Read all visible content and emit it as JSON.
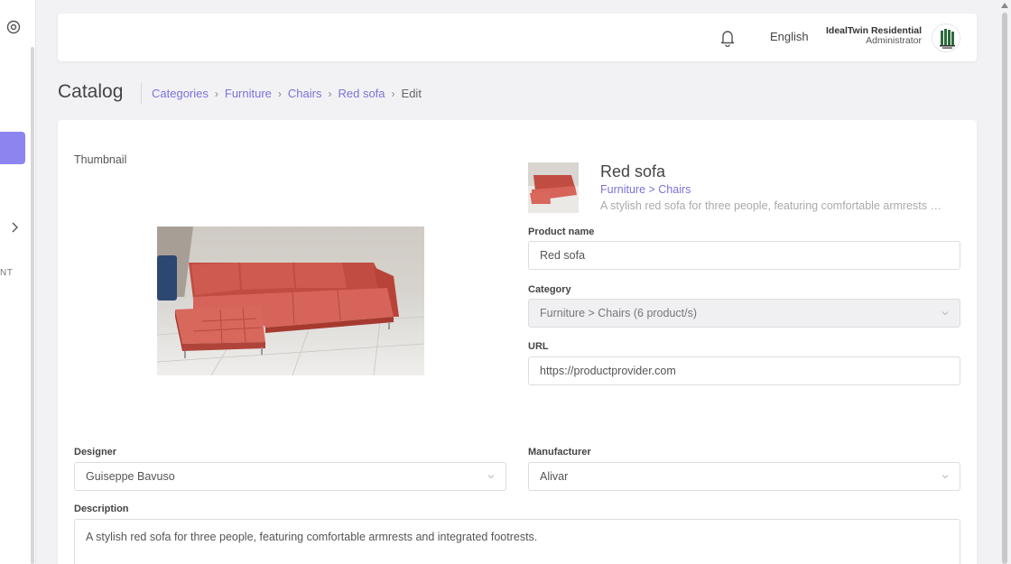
{
  "sidebar": {
    "cut_label": "NT"
  },
  "header": {
    "language": "English",
    "user_name": "IdealTwin Residential",
    "user_role": "Administrator"
  },
  "page": {
    "title": "Catalog",
    "breadcrumb": [
      {
        "label": "Categories"
      },
      {
        "label": "Furniture"
      },
      {
        "label": "Chairs"
      },
      {
        "label": "Red sofa"
      }
    ],
    "breadcrumb_current": "Edit"
  },
  "thumbnail": {
    "label": "Thumbnail"
  },
  "preview": {
    "name": "Red sofa",
    "path": "Furniture > Chairs",
    "description": "A stylish red sofa for three people, featuring comfortable armrests and integrated footrests."
  },
  "form": {
    "product_name_label": "Product name",
    "product_name_value": "Red sofa",
    "category_label": "Category",
    "category_value": "Furniture > Chairs (6 product/s)",
    "url_label": "URL",
    "url_value": "https://productprovider.com",
    "designer_label": "Designer",
    "designer_value": "Guiseppe Bavuso",
    "manufacturer_label": "Manufacturer",
    "manufacturer_value": "Alivar",
    "description_label": "Description",
    "description_value": "A stylish red sofa for three people, featuring comfortable armrests and integrated footrests."
  },
  "colors": {
    "accent": "#7b72d9",
    "sidebar_active": "#8d84f0",
    "sofa": "#d2574c"
  },
  "icons": {
    "sidebar_top": "target-circle-icon",
    "sidebar_expand": "chevron-right-icon",
    "notifications": "bell-icon",
    "dropdown": "chevron-down-icon"
  }
}
